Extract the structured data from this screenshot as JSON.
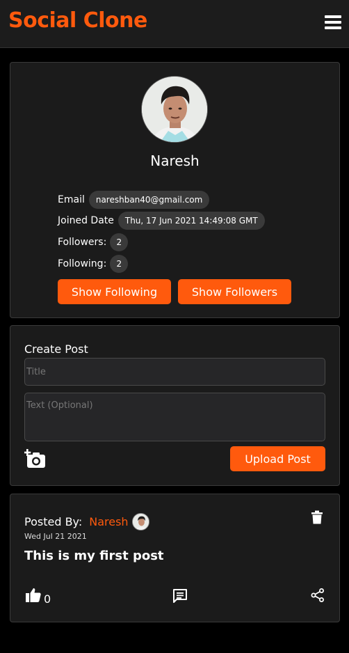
{
  "navbar": {
    "brand": "Social Clone",
    "menu_icon": "hamburger-menu-icon"
  },
  "profile": {
    "name": "Naresh",
    "email_label": "Email",
    "email": "nareshban40@gmail.com",
    "joined_label": "Joined Date",
    "joined": "Thu, 17 Jun 2021 14:49:08 GMT",
    "followers_label": "Followers:",
    "followers": "2",
    "following_label": "Following:",
    "following": "2",
    "show_following": "Show Following",
    "show_followers": "Show Followers"
  },
  "create_post": {
    "heading": "Create Post",
    "title_placeholder": "Title",
    "text_placeholder": "Text (Optional)",
    "upload_label": "Upload Post",
    "camera_icon": "add-photo-camera-icon"
  },
  "post": {
    "posted_by_label": "Posted By:",
    "author": "Naresh",
    "date": "Wed Jul 21 2021",
    "title": "This is my first post",
    "likes": "0",
    "icons": [
      "delete-icon",
      "like-icon",
      "comment-icon",
      "share-icon"
    ]
  },
  "colors": {
    "accent": "#ff5a0d",
    "card_bg": "#1b1b1b",
    "page_bg": "#000000",
    "pill_bg": "#3a3a3a"
  }
}
